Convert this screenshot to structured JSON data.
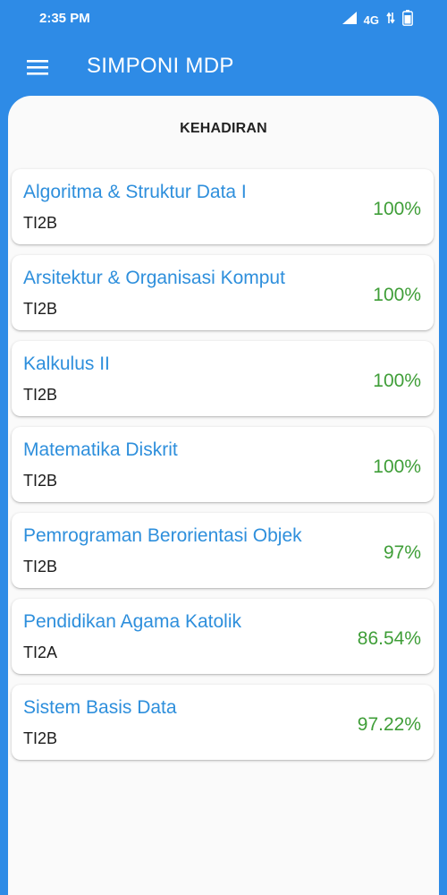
{
  "status_bar": {
    "time": "2:35 PM",
    "network": "4G",
    "signal_icon": "signal-icon",
    "battery_icon": "battery-icon"
  },
  "app_bar": {
    "title": "SIMPONI MDP",
    "menu_icon": "hamburger-menu-icon"
  },
  "section": {
    "title": "KEHADIRAN"
  },
  "colors": {
    "primary": "#2e8be6",
    "course_name": "#2e8fdc",
    "percentage": "#3f9e38",
    "background": "#fafafa"
  },
  "courses": [
    {
      "name": "Algoritma & Struktur Data I",
      "class": "TI2B",
      "attendance": "100%"
    },
    {
      "name": "Arsitektur & Organisasi Komput",
      "class": "TI2B",
      "attendance": "100%"
    },
    {
      "name": "Kalkulus II",
      "class": "TI2B",
      "attendance": "100%"
    },
    {
      "name": "Matematika Diskrit",
      "class": "TI2B",
      "attendance": "100%"
    },
    {
      "name": "Pemrograman Berorientasi Objek",
      "class": "TI2B",
      "attendance": "97%"
    },
    {
      "name": "Pendidikan Agama Katolik",
      "class": "TI2A",
      "attendance": "86.54%"
    },
    {
      "name": "Sistem Basis Data",
      "class": "TI2B",
      "attendance": "97.22%"
    }
  ]
}
